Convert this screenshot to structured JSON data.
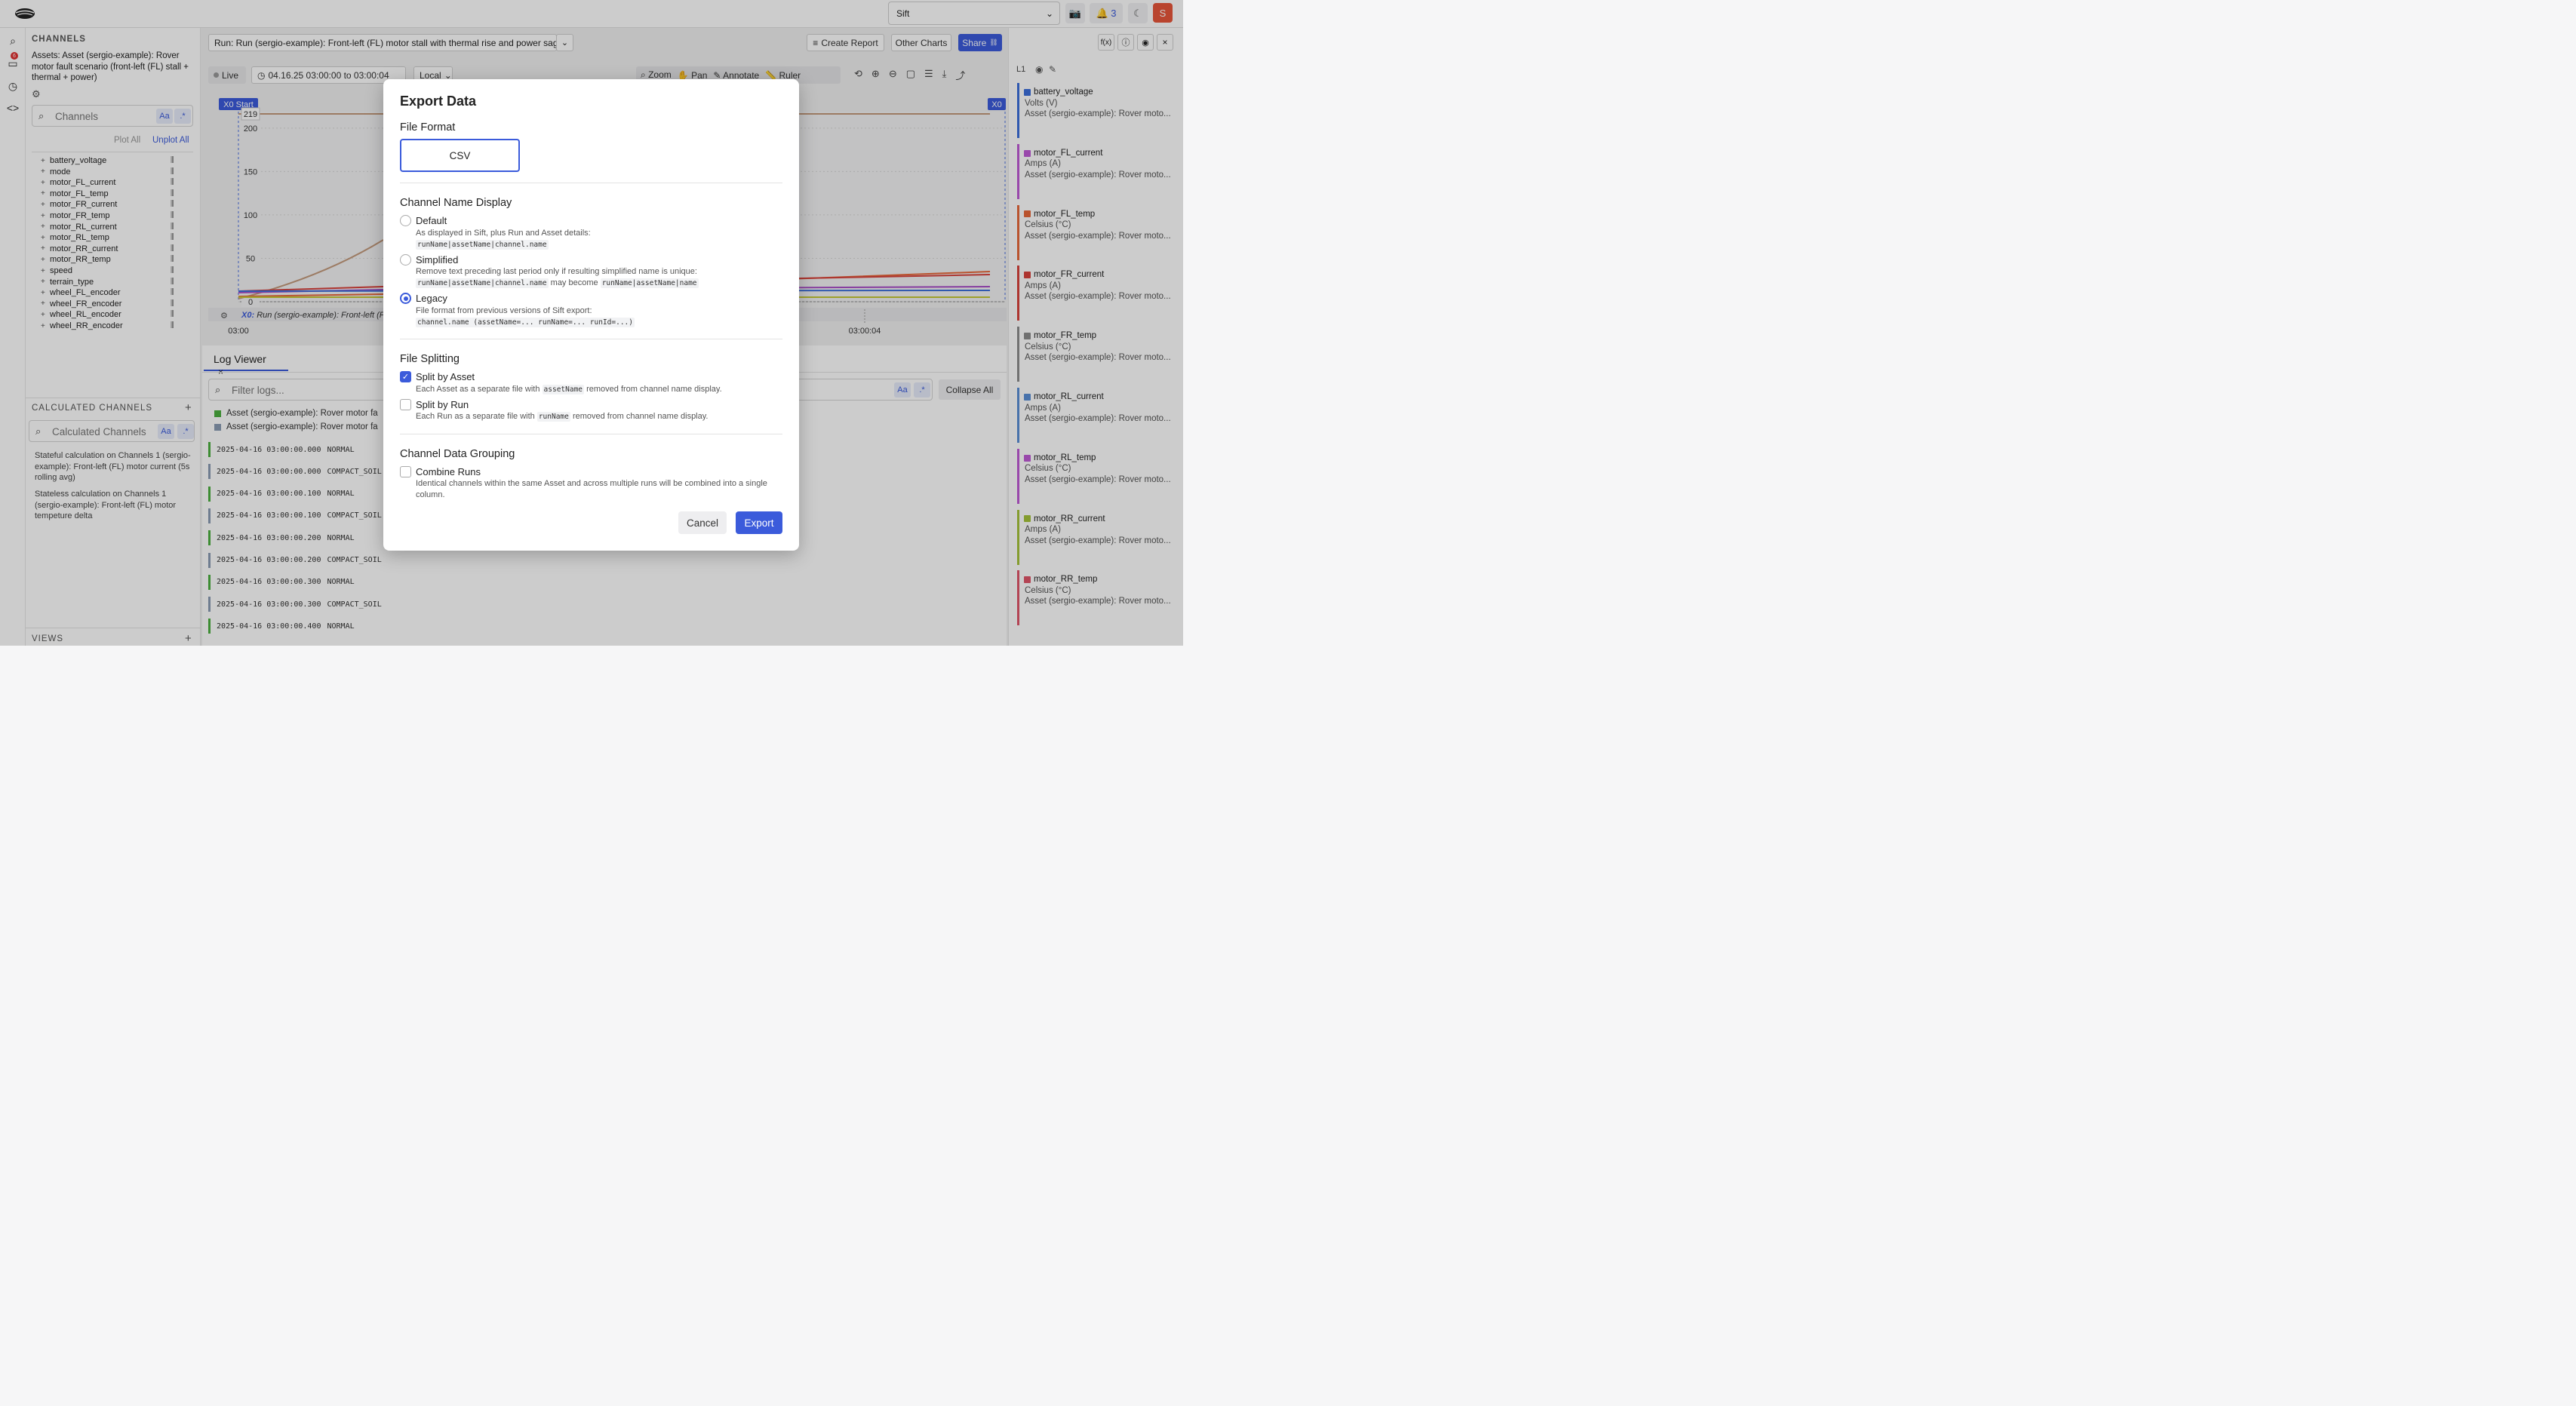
{
  "topbar": {
    "workspace": "Sift",
    "notifications_count": "3",
    "user_initial": "S"
  },
  "leftnav": {
    "badge": "6"
  },
  "channels": {
    "header": "CHANNELS",
    "asset_title": "Assets: Asset (sergio-example): Rover motor fault scenario (front-left (FL) stall + thermal + power)",
    "search_placeholder": "Channels",
    "case_toggle": "Aa",
    "regex_toggle": ".*",
    "plot_all": "Plot All",
    "unplot_all": "Unplot All",
    "items": [
      "battery_voltage",
      "mode",
      "motor_FL_current",
      "motor_FL_temp",
      "motor_FR_current",
      "motor_FR_temp",
      "motor_RL_current",
      "motor_RL_temp",
      "motor_RR_current",
      "motor_RR_temp",
      "speed",
      "terrain_type",
      "wheel_FL_encoder",
      "wheel_FR_encoder",
      "wheel_RL_encoder",
      "wheel_RR_encoder"
    ]
  },
  "calculated": {
    "header": "CALCULATED CHANNELS",
    "search_placeholder": "Calculated Channels",
    "items": [
      "Stateful calculation on Channels 1 (sergio-example): Front-left (FL) motor current (5s rolling avg)",
      "Stateless calculation on Channels 1 (sergio-example): Front-left (FL) motor tempeture delta"
    ]
  },
  "views": {
    "header": "VIEWS"
  },
  "main": {
    "run_title": "Run: Run (sergio-example): Front-left (FL) motor stall with thermal rise and power sag",
    "create_report": "Create Report",
    "other_charts": "Other Charts",
    "share": "Share",
    "live": "Live",
    "time_range": "04.16.25 03:00:00 to 03:00:04",
    "timezone": "Local",
    "zoom": "Zoom",
    "pan": "Pan",
    "annotate": "Annotate",
    "ruler": "Ruler"
  },
  "chart": {
    "x0_start": "X0 Start",
    "x0_end": "X0",
    "max_label": "219",
    "y_ticks": [
      "200",
      "150",
      "100",
      "50",
      "0"
    ],
    "x_ticks": [
      "03:00",
      "03:00:04"
    ],
    "annotation_prefix": "X0:",
    "annotation_text": "Run (sergio-example): Front-left (FL",
    "colors": {
      "tan": "#c49a7c",
      "orange": "#e8683a",
      "red": "#d9433c",
      "blue": "#3b6fdb",
      "purple": "#a94fc9",
      "yellow": "#c6c935"
    }
  },
  "chart_data": {
    "type": "line",
    "title": "",
    "xlabel": "",
    "ylabel": "",
    "ylim": [
      0,
      219
    ],
    "x": [
      "03:00",
      "03:00:04"
    ]
  },
  "log": {
    "tab": "Log Viewer",
    "filter_placeholder": "Filter logs...",
    "collapse_all": "Collapse All",
    "sources": [
      {
        "label": "Asset (sergio-example): Rover motor fa",
        "color": "#4caf3f"
      },
      {
        "label": "Asset (sergio-example): Rover motor fa",
        "color": "#8a9bb3"
      }
    ],
    "rows": [
      {
        "ts": "2025-04-16 03:00:00.000",
        "level": "NORMAL",
        "color": "#4caf3f"
      },
      {
        "ts": "2025-04-16 03:00:00.000",
        "level": "COMPACT_SOIL",
        "color": "#8a9bb3"
      },
      {
        "ts": "2025-04-16 03:00:00.100",
        "level": "NORMAL",
        "color": "#4caf3f"
      },
      {
        "ts": "2025-04-16 03:00:00.100",
        "level": "COMPACT_SOIL",
        "color": "#8a9bb3"
      },
      {
        "ts": "2025-04-16 03:00:00.200",
        "level": "NORMAL",
        "color": "#4caf3f"
      },
      {
        "ts": "2025-04-16 03:00:00.200",
        "level": "COMPACT_SOIL",
        "color": "#8a9bb3"
      },
      {
        "ts": "2025-04-16 03:00:00.300",
        "level": "NORMAL",
        "color": "#4caf3f"
      },
      {
        "ts": "2025-04-16 03:00:00.300",
        "level": "COMPACT_SOIL",
        "color": "#8a9bb3"
      },
      {
        "ts": "2025-04-16 03:00:00.400",
        "level": "NORMAL",
        "color": "#4caf3f"
      }
    ]
  },
  "legend": {
    "layer": "L1",
    "cards": [
      {
        "name": "battery_voltage",
        "unit": "Volts (V)",
        "asset": "Asset (sergio-example): Rover moto...",
        "color": "#3b6fdb"
      },
      {
        "name": "motor_FL_current",
        "unit": "Amps (A)",
        "asset": "Asset (sergio-example): Rover moto...",
        "color": "#c05ad6"
      },
      {
        "name": "motor_FL_temp",
        "unit": "Celsius (°C)",
        "asset": "Asset (sergio-example): Rover moto...",
        "color": "#e8683a"
      },
      {
        "name": "motor_FR_current",
        "unit": "Amps (A)",
        "asset": "Asset (sergio-example): Rover moto...",
        "color": "#d9433c"
      },
      {
        "name": "motor_FR_temp",
        "unit": "Celsius (°C)",
        "asset": "Asset (sergio-example): Rover moto...",
        "color": "#8c8c8c"
      },
      {
        "name": "motor_RL_current",
        "unit": "Amps (A)",
        "asset": "Asset (sergio-example): Rover moto...",
        "color": "#5b8fd6"
      },
      {
        "name": "motor_RL_temp",
        "unit": "Celsius (°C)",
        "asset": "Asset (sergio-example): Rover moto...",
        "color": "#c05ad6"
      },
      {
        "name": "motor_RR_current",
        "unit": "Amps (A)",
        "asset": "Asset (sergio-example): Rover moto...",
        "color": "#a5c43a"
      },
      {
        "name": "motor_RR_temp",
        "unit": "Celsius (°C)",
        "asset": "Asset (sergio-example): Rover moto...",
        "color": "#e0566a"
      }
    ]
  },
  "modal": {
    "title": "Export Data",
    "file_format_label": "File Format",
    "file_format_value": "CSV",
    "channel_name_display": "Channel Name Display",
    "options": {
      "default": {
        "label": "Default",
        "desc": "As displayed in Sift, plus Run and Asset details:",
        "code": "runName|assetName|channel.name"
      },
      "simplified": {
        "label": "Simplified",
        "desc": "Remove text preceding last period only if resulting simplified name is unique:",
        "code1": "runName|assetName|channel.name",
        "mid": "may become",
        "code2": "runName|assetName|name"
      },
      "legacy": {
        "label": "Legacy",
        "desc": "File format from previous versions of Sift export:",
        "code": "channel.name (assetName=... runName=... runId=...)"
      }
    },
    "file_splitting": "File Splitting",
    "split_asset": {
      "label": "Split by Asset",
      "pre": "Each Asset as a separate file with",
      "code": "assetName",
      "post": "removed from channel name display."
    },
    "split_run": {
      "label": "Split by Run",
      "pre": "Each Run as a separate file with",
      "code": "runName",
      "post": "removed from channel name display."
    },
    "grouping": "Channel Data Grouping",
    "combine": {
      "label": "Combine Runs",
      "desc": "Identical channels within the same Asset and across multiple runs will be combined into a single column."
    },
    "cancel": "Cancel",
    "export": "Export"
  }
}
